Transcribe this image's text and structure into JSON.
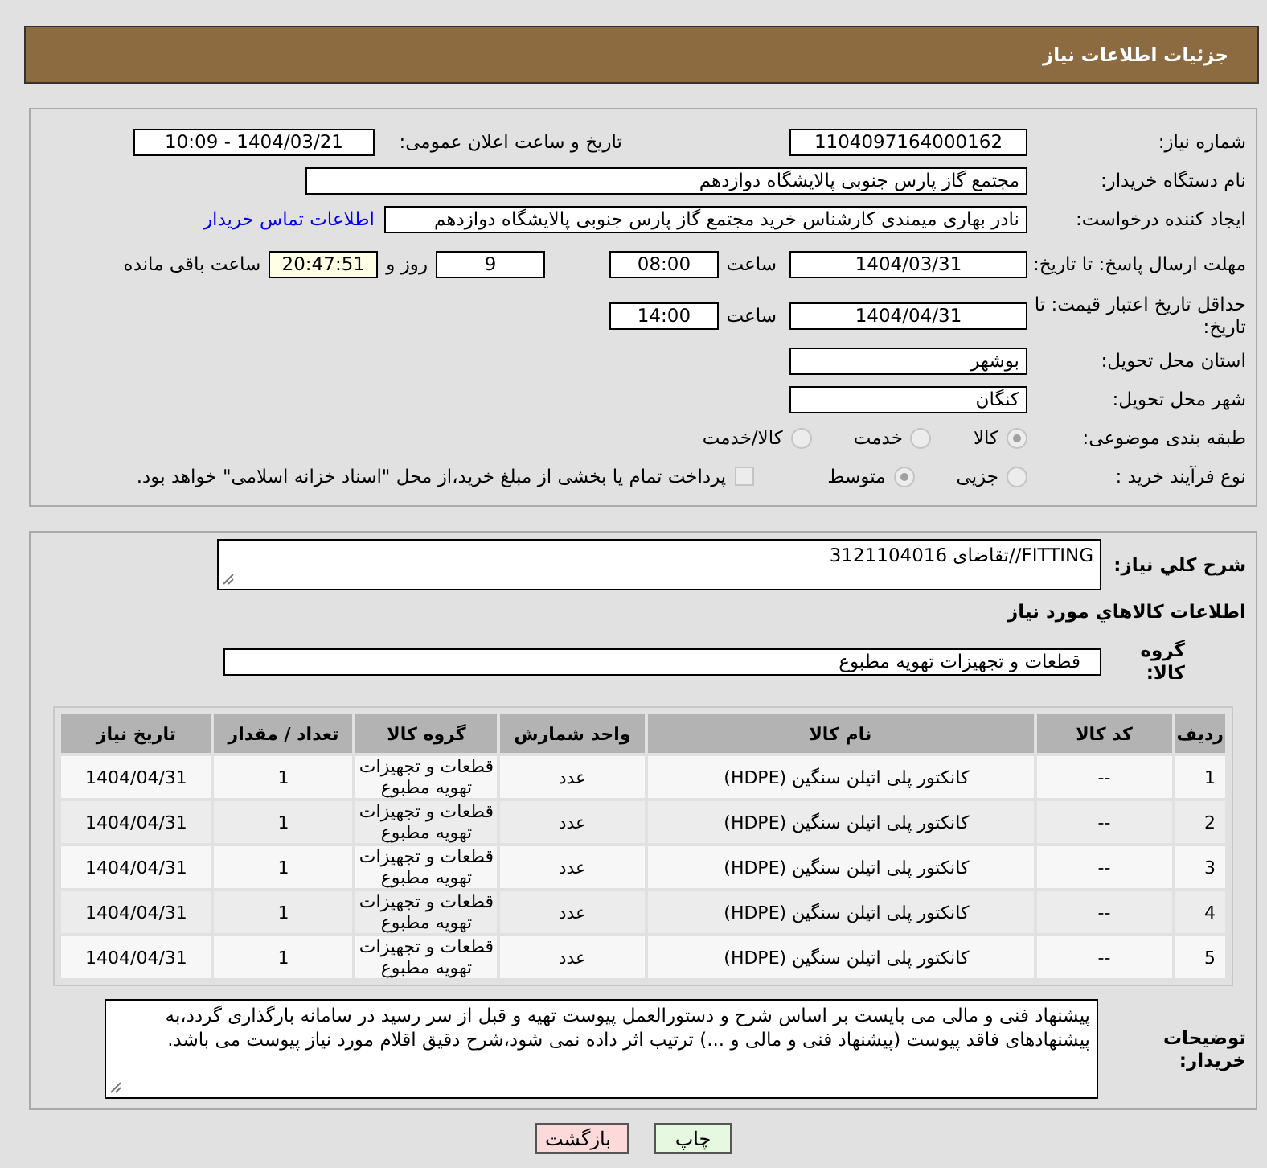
{
  "header": {
    "title": "جزئیات اطلاعات نیاز"
  },
  "need_info": {
    "need_number": {
      "label": "شماره نیاز:",
      "value": "1104097164000162"
    },
    "announce_datetime": {
      "label": "تاریخ و ساعت اعلان عمومی:",
      "value": "1404/03/21 - 10:09"
    },
    "buyer_org": {
      "label": "نام دستگاه خریدار:",
      "value": "مجتمع گاز پارس جنوبی  پالایشگاه دوازدهم"
    },
    "requester": {
      "label": "ایجاد کننده درخواست:",
      "value": "نادر بهاری میمندی کارشناس خرید مجتمع گاز پارس جنوبی  پالایشگاه دوازدهم",
      "link": "اطلاعات تماس خریدار"
    },
    "reply_deadline": {
      "label": "مهلت ارسال پاسخ: تا تاریخ:",
      "date": "1404/03/31",
      "time_label": "ساعت",
      "time": "08:00",
      "days": "9",
      "days_label": "روز و",
      "remaining": "20:47:51",
      "remaining_label": "ساعت باقی مانده"
    },
    "price_validity": {
      "label": "حداقل تاریخ اعتبار قیمت: تا تاریخ:",
      "date": "1404/04/31",
      "time_label": "ساعت",
      "time": "14:00"
    },
    "province": {
      "label": "استان محل تحویل:",
      "value": "بوشهر"
    },
    "city": {
      "label": "شهر محل تحویل:",
      "value": "کنگان"
    },
    "category": {
      "label": "طبقه بندی موضوعی:",
      "options": [
        {
          "label": "کالا",
          "selected": true
        },
        {
          "label": "خدمت",
          "selected": false
        },
        {
          "label": "کالا/خدمت",
          "selected": false
        }
      ]
    },
    "purchase_process": {
      "label": "نوع فرآیند خرید :",
      "options": [
        {
          "label": "جزیی",
          "selected": false
        },
        {
          "label": "متوسط",
          "selected": true
        }
      ],
      "treasury": {
        "label": "پرداخت تمام یا بخشی از مبلغ خرید،از محل \"اسناد خزانه اسلامی\" خواهد بود.",
        "checked": false
      }
    }
  },
  "goods": {
    "description": {
      "label": "شرح کلي نياز:",
      "value": "FITTING//تقاضای 3121104016"
    },
    "heading": "اطلاعات کالاهاي مورد نياز",
    "group": {
      "label": "گروه کالا:",
      "value": "قطعات و تجهیزات تهویه مطبوع"
    },
    "table": {
      "columns": [
        "ردیف",
        "کد کالا",
        "نام کالا",
        "واحد شمارش",
        "گروه کالا",
        "تعداد / مقدار",
        "تاریخ نیاز"
      ],
      "rows": [
        [
          "1",
          "--",
          "کانکتور پلی اتیلن سنگین (HDPE)",
          "عدد",
          "قطعات و تجهیزات تهویه مطبوع",
          "1",
          "1404/04/31"
        ],
        [
          "2",
          "--",
          "کانکتور پلی اتیلن سنگین (HDPE)",
          "عدد",
          "قطعات و تجهیزات تهویه مطبوع",
          "1",
          "1404/04/31"
        ],
        [
          "3",
          "--",
          "کانکتور پلی اتیلن سنگین (HDPE)",
          "عدد",
          "قطعات و تجهیزات تهویه مطبوع",
          "1",
          "1404/04/31"
        ],
        [
          "4",
          "--",
          "کانکتور پلی اتیلن سنگین (HDPE)",
          "عدد",
          "قطعات و تجهیزات تهویه مطبوع",
          "1",
          "1404/04/31"
        ],
        [
          "5",
          "--",
          "کانکتور پلی اتیلن سنگین (HDPE)",
          "عدد",
          "قطعات و تجهیزات تهویه مطبوع",
          "1",
          "1404/04/31"
        ]
      ]
    },
    "buyer_notes": {
      "label": "توضیحات خریدار:",
      "value": "پیشنهاد فنی و مالی می بایست بر اساس شرح و دستورالعمل پیوست تهیه و قبل از سر رسید در سامانه بارگذاری گردد،به پیشنهادهای فاقد پیوست (پیشنهاد فنی و مالی و ...) ترتیب اثر داده نمی شود،شرح دقیق اقلام مورد نیاز پیوست می باشد."
    }
  },
  "buttons": [
    {
      "label": "چاپ",
      "kind": "print"
    },
    {
      "label": "بازگشت",
      "kind": "back"
    }
  ]
}
